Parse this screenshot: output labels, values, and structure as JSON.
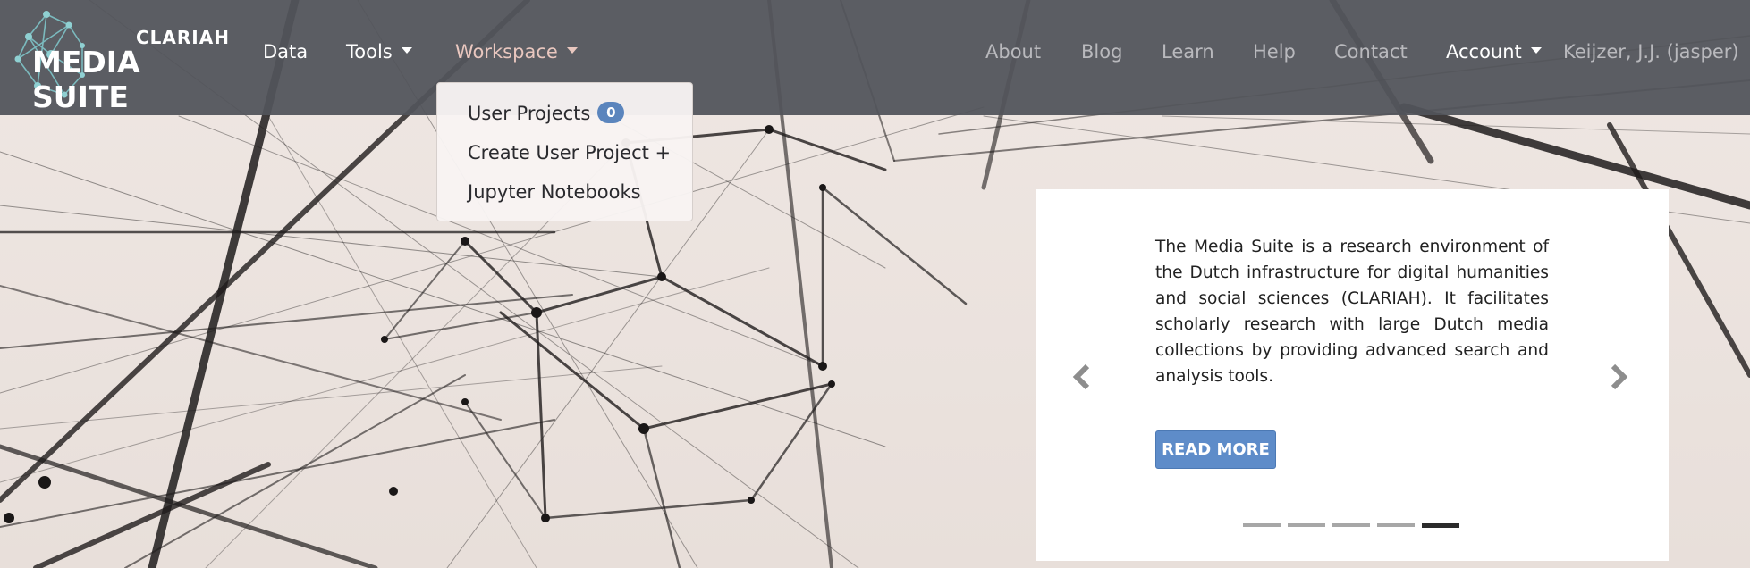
{
  "brand": {
    "top": "CLARIAH",
    "main": "MEDIA SUITE",
    "logo_icon": "network-logo-icon"
  },
  "nav": {
    "left": [
      {
        "label": "Data",
        "dropdown": false
      },
      {
        "label": "Tools",
        "dropdown": true
      },
      {
        "label": "Workspace",
        "dropdown": true,
        "open": true
      }
    ],
    "right": [
      {
        "label": "About"
      },
      {
        "label": "Blog"
      },
      {
        "label": "Learn"
      },
      {
        "label": "Help"
      },
      {
        "label": "Contact"
      },
      {
        "label": "Account",
        "dropdown": true
      }
    ],
    "user": "Keijzer, J.J. (jasper)"
  },
  "workspace_menu": {
    "items": [
      {
        "label": "User Projects",
        "badge": "0"
      },
      {
        "label": "Create User Project +"
      },
      {
        "label": "Jupyter Notebooks"
      }
    ]
  },
  "carousel": {
    "text": "The Media Suite is a research environment of the Dutch infrastructure for digital humanities and social sciences (CLARIAH). It facilitates scholarly research with large Dutch media collections by providing advanced search and analysis tools.",
    "button": "READ MORE",
    "prev_icon": "chevron-left-icon",
    "next_icon": "chevron-right-icon",
    "slide_count": 5,
    "active_slide": 5
  },
  "colors": {
    "navbar": "#52545a",
    "accent": "#5e8cc9",
    "badge": "#5b85bd",
    "hero_bg": "#ece4e0"
  }
}
